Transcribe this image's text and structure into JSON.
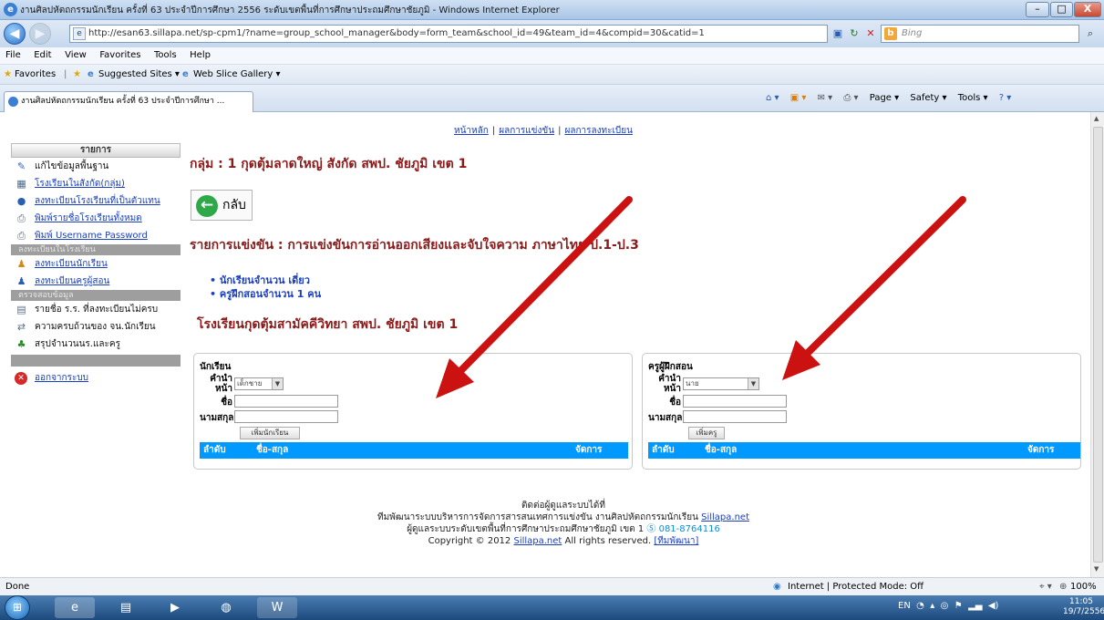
{
  "window": {
    "title": "งานศิลปหัตถกรรมนักเรียน ครั้งที่ 63 ประจำปีการศึกษา 2556 ระดับเขตพื้นที่การศึกษาประถมศึกษาชัยภูมิ - Windows Internet Explorer",
    "minimize": "–",
    "maximize": "□",
    "close": "X"
  },
  "address_bar": {
    "url": "http://esan63.sillapa.net/sp-cpm1/?name=group_school_manager&body=form_team&school_id=49&team_id=4&compid=30&catid=1",
    "search_placeholder": "Bing",
    "back_icon": "◀",
    "forward_icon": "▶"
  },
  "menu": [
    "File",
    "Edit",
    "View",
    "Favorites",
    "Tools",
    "Help"
  ],
  "favorites_bar": {
    "favorites": "Favorites",
    "suggested": "Suggested Sites ▾",
    "webslice": "Web Slice Gallery ▾"
  },
  "tab": {
    "title": "งานศิลปหัตถกรรมนักเรียน ครั้งที่ 63 ประจำปีการศึกษา ..."
  },
  "command_bar": [
    "Page ▾",
    "Safety ▾",
    "Tools ▾"
  ],
  "top_links": [
    "หน้าหลัก",
    "ผลการแข่งขัน",
    "ผลการลงทะเบียน"
  ],
  "sidebar": {
    "header": "รายการ",
    "items_top": [
      {
        "label": "แก้ไขข้อมูลพื้นฐาน",
        "link": false
      },
      {
        "label": "โรงเรียนในสังกัด(กลุ่ม)",
        "link": true
      },
      {
        "label": "ลงทะเบียนโรงเรียนที่เป็นตัวแทน",
        "link": true
      },
      {
        "label": "พิมพ์รายชื่อโรงเรียนทั้งหมด",
        "link": true
      },
      {
        "label": "พิมพ์ Username Password",
        "link": true
      }
    ],
    "section1": "ลงทะเบียนในโรงเรียน",
    "items_mid": [
      {
        "label": "ลงทะเบียนนักเรียน",
        "link": true
      },
      {
        "label": "ลงทะเบียนครูผู้สอน",
        "link": true
      }
    ],
    "section2": "ตรวจสอบข้อมูล",
    "items_check": [
      {
        "label": "รายชื่อ ร.ร. ที่ลงทะเบียนไม่ครบ",
        "link": false
      },
      {
        "label": "ความครบถ้วนของ จน.นักเรียน",
        "link": false
      },
      {
        "label": "สรุปจำนวนนร.และครู",
        "link": false
      }
    ],
    "logout": "ออกจากระบบ"
  },
  "main": {
    "group_title": "กลุ่ม : 1 กุดตุ้มลาดใหญ่ สังกัด สพป. ชัยภูมิ เขต 1",
    "back_label": "กลับ",
    "competition_title": "รายการแข่งขัน : การแข่งขันการอ่านออกเสียงและจับใจความ ภาษาไทย ป.1-ป.3",
    "bullets": [
      "นักเรียนจำนวน เดี่ยว",
      "ครูฝึกสอนจำนวน 1 คน"
    ],
    "school_title": "โรงเรียนกุดตุ้มสามัคคีวิทยา สพป. ชัยภูมิ เขต 1"
  },
  "student_panel": {
    "header": "นักเรียน",
    "prefix_label": "คำนำหน้า",
    "prefix_value": "เด็กชาย",
    "name_label": "ชื่อ",
    "surname_label": "นามสกุล",
    "add_button": "เพิ่มนักเรียน",
    "col_no": "ลำดับ",
    "col_name": "ชื่อ-สกุล",
    "col_manage": "จัดการ"
  },
  "teacher_panel": {
    "header": "ครูผู้ฝึกสอน",
    "prefix_label": "คำนำหน้า",
    "prefix_value": "นาย",
    "name_label": "ชื่อ",
    "surname_label": "นามสกุล",
    "add_button": "เพิ่มครู",
    "col_no": "ลำดับ",
    "col_name": "ชื่อ-สกุล",
    "col_manage": "จัดการ"
  },
  "footer": {
    "line1": "ติดต่อผู้ดูแลระบบได้ที่",
    "line2_text": "ทีมพัฒนาระบบบริหารการจัดการสารสนเทศการแข่งขัน งานศิลปหัตถกรรมนักเรียน",
    "line2_link": "Sillapa.net",
    "line3_text": "ผู้ดูแลระบบระดับเขตพื้นที่การศึกษาประถมศึกษาชัยภูมิ เขต 1",
    "line3_phone": "081-8764116",
    "line4_a": "Copyright © 2012",
    "line4_link": "Sillapa.net",
    "line4_b": "All rights reserved.",
    "line4_team": "[ทีมพัฒนา]"
  },
  "status_bar": {
    "done": "Done",
    "zone": "Internet | Protected Mode: Off",
    "zoom": "100%"
  },
  "taskbar": {
    "lang": "EN",
    "time": "11:05",
    "date": "19/7/2556"
  },
  "colors": {
    "heading_red": "#8b1a1a",
    "link_blue": "#1a3fbf",
    "table_header": "#0099ff",
    "arrow_red": "#cc1111"
  }
}
